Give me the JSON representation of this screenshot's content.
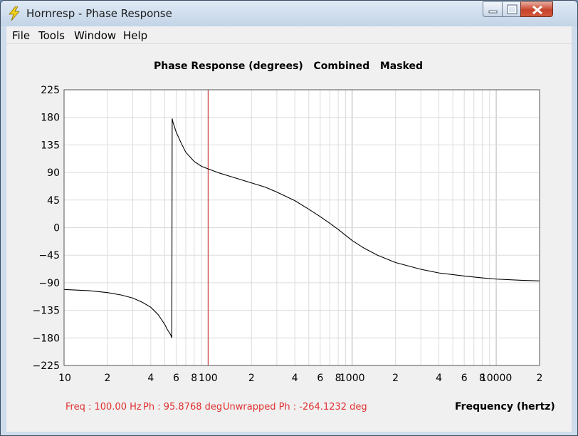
{
  "window": {
    "title": "Hornresp - Phase Response"
  },
  "menu": {
    "items": [
      "File",
      "Tools",
      "Window",
      "Help"
    ]
  },
  "chart_data": {
    "type": "line",
    "title": "Phase Response (degrees)   Combined   Masked",
    "xlabel": "Frequency (hertz)",
    "ylabel": "",
    "xscale": "log",
    "xlim": [
      10,
      20000
    ],
    "ylim": [
      -225,
      225
    ],
    "y_ticks": [
      "225",
      "180",
      "135",
      "90",
      "45",
      "0",
      "−45",
      "−90",
      "−135",
      "−180",
      "−225"
    ],
    "y_tick_values": [
      225,
      180,
      135,
      90,
      45,
      0,
      -45,
      -90,
      -135,
      -180,
      -225
    ],
    "x_tick_labels": [
      "10",
      "2",
      "4",
      "6",
      "8",
      "100",
      "2",
      "4",
      "6",
      "8",
      "1000",
      "2",
      "4",
      "6",
      "8",
      "10000",
      "2"
    ],
    "x_tick_values": [
      10,
      20,
      40,
      60,
      80,
      100,
      200,
      400,
      600,
      800,
      1000,
      2000,
      4000,
      6000,
      8000,
      10000,
      20000
    ],
    "grid": true,
    "cursor": {
      "x": 100,
      "color": "#cc2020"
    },
    "series": [
      {
        "color": "#000000",
        "x": [
          10,
          15,
          20,
          25,
          30,
          35,
          40,
          45,
          50,
          52,
          55,
          56,
          56.3,
          57,
          60,
          65,
          70,
          80,
          90,
          100,
          120,
          150,
          200,
          250,
          300,
          400,
          500,
          600,
          700,
          800,
          1000,
          1200,
          1500,
          2000,
          3000,
          4000,
          6000,
          8000,
          10000,
          15000,
          20000
        ],
        "y": [
          -101,
          -103,
          -106,
          -110,
          -115,
          -122,
          -130,
          -142,
          -158,
          -166,
          -175,
          -180,
          178,
          172,
          156,
          138,
          123,
          108,
          100,
          95.9,
          89,
          82,
          73,
          66,
          58,
          44,
          30,
          18,
          7,
          -3,
          -21,
          -33,
          -45,
          -57,
          -68,
          -74,
          -79,
          -82,
          -84,
          -86,
          -87
        ]
      }
    ]
  },
  "status": {
    "freq": "Freq : 100.00 Hz",
    "phase": "Ph : 95.8768 deg",
    "unwrapped": "Unwrapped Ph : -264.1232 deg"
  }
}
